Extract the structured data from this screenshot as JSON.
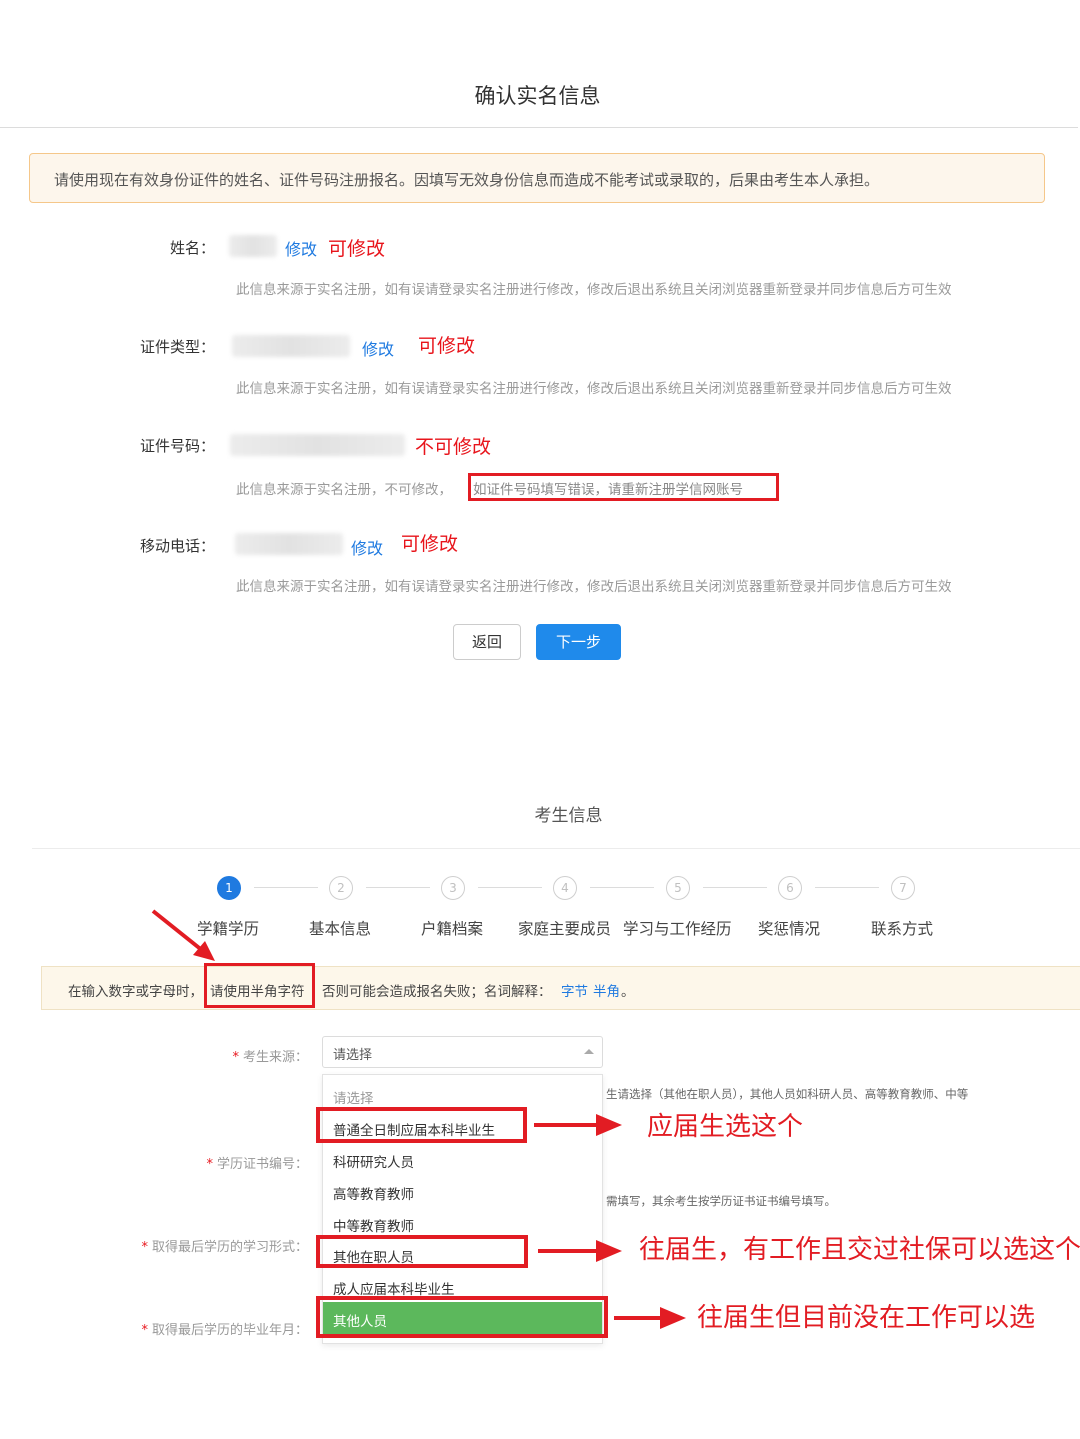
{
  "header": {
    "title": "确认实名信息"
  },
  "notice": {
    "text": "请使用现在有效身份证件的姓名、证件号码注册报名。因填写无效身份信息而造成不能考试或录取的，后果由考生本人承担。"
  },
  "fields": {
    "name": {
      "label": "姓名：",
      "edit": "修改",
      "annotation": "可修改",
      "hint": "此信息来源于实名注册，如有误请登录实名注册进行修改，修改后退出系统且关闭浏览器重新登录并同步信息后方可生效"
    },
    "id_type": {
      "label": "证件类型：",
      "edit": "修改",
      "annotation": "可修改",
      "hint": "此信息来源于实名注册，如有误请登录实名注册进行修改，修改后退出系统且关闭浏览器重新登录并同步信息后方可生效"
    },
    "id_number": {
      "label": "证件号码：",
      "annotation": "不可修改",
      "hint_prefix": "此信息来源于实名注册，不可修改，",
      "hint_highlight": "如证件号码填写错误，请重新注册学信网账号"
    },
    "phone": {
      "label": "移动电话：",
      "edit": "修改",
      "annotation": "可修改",
      "hint": "此信息来源于实名注册，如有误请登录实名注册进行修改，修改后退出系统且关闭浏览器重新登录并同步信息后方可生效"
    }
  },
  "buttons": {
    "back": "返回",
    "next": "下一步"
  },
  "section2": {
    "title": "考生信息"
  },
  "steps": [
    {
      "num": "1",
      "label": "学籍学历"
    },
    {
      "num": "2",
      "label": "基本信息"
    },
    {
      "num": "3",
      "label": "户籍档案"
    },
    {
      "num": "4",
      "label": "家庭主要成员"
    },
    {
      "num": "5",
      "label": "学习与工作经历"
    },
    {
      "num": "6",
      "label": "奖惩情况"
    },
    {
      "num": "7",
      "label": "联系方式"
    }
  ],
  "notice2": {
    "prefix": "在输入数字或字母时，",
    "highlight": "请使用半角字符",
    "middle": "否则可能会造成报名失败；名词解释：",
    "link1": "字节",
    "link2": "半角",
    "suffix": "。"
  },
  "form": {
    "source_label": "考生来源：",
    "source_value": "请选择",
    "cert_label": "学历证书编号：",
    "study_form_label": "取得最后学历的学习形式：",
    "grad_date_label": "取得最后学历的毕业年月：",
    "side_hint1": "生请选择（其他在职人员），其他人员如科研人员、高等教育教师、中等",
    "side_hint2": "需填写，其余考生按学历证书证书编号填写。"
  },
  "dropdown_options": [
    "请选择",
    "普通全日制应届本科毕业生",
    "科研研究人员",
    "高等教育教师",
    "中等教育教师",
    "其他在职人员",
    "成人应届本科毕业生",
    "其他人员"
  ],
  "annotations": {
    "fresh": "应届生选这个",
    "employed": "往届生，有工作且交过社保可以选这个",
    "other": "往届生但目前没在工作可以选"
  },
  "colors": {
    "accent": "#1f7ae0",
    "annotation_red": "#e21c23",
    "selected_green": "#5cb85c"
  }
}
